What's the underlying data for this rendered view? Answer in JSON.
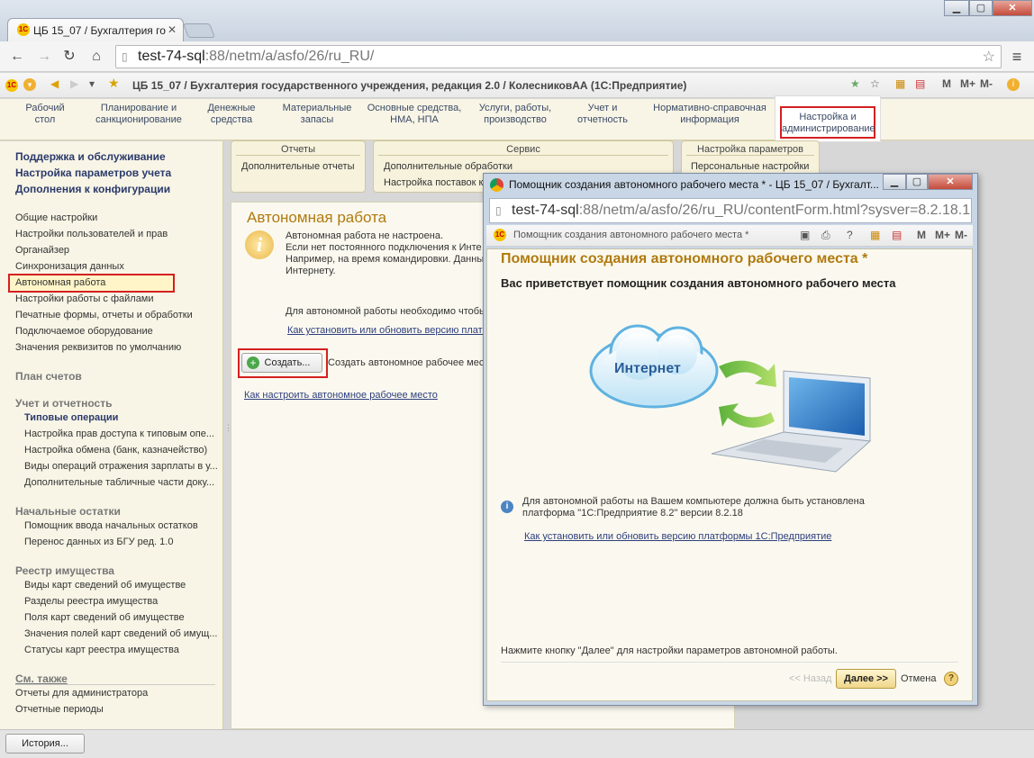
{
  "browser": {
    "tab_title": "ЦБ 15_07 / Бухгалтерия го",
    "url_host": "test-74-sql",
    "url_rest": ":88/netm/a/asfo/26/ru_RU/"
  },
  "app": {
    "title": "ЦБ 15_07 / Бухгалтерия государственного учреждения, редакция 2.0 / КолесниковАА (1С:Предприятие)",
    "toolbar_right": [
      "M",
      "M+",
      "M-"
    ]
  },
  "sections": [
    {
      "label": "Рабочий\nстол"
    },
    {
      "label": "Планирование и\nсанкционирование"
    },
    {
      "label": "Денежные\nсредства"
    },
    {
      "label": "Материальные\nзапасы"
    },
    {
      "label": "Основные средства,\nНМА, НПА"
    },
    {
      "label": "Услуги, работы,\nпроизводство"
    },
    {
      "label": "Учет и\nотчетность"
    },
    {
      "label": "Нормативно-справочная\nинформация"
    },
    {
      "label": "Настройка и\nадминистрирование"
    }
  ],
  "left": {
    "top_links": [
      "Поддержка и обслуживание",
      "Настройка параметров учета",
      "Дополнения к конфигурации"
    ],
    "settings": [
      "Общие настройки",
      "Настройки пользователей и прав",
      "Органайзер",
      "Синхронизация данных",
      "Автономная работа",
      "Настройки работы с файлами",
      "Печатные формы, отчеты и обработки",
      "Подключаемое оборудование",
      "Значения реквизитов по умолчанию"
    ],
    "plan": "План счетов",
    "accounting_header": "Учет и отчетность",
    "accounting_sub": "Типовые операции",
    "accounting_items": [
      "Настройка прав доступа к типовым опе...",
      "Настройка обмена (банк, казначейство)",
      "Виды операций отражения зарплаты в у...",
      "Дополнительные табличные части доку..."
    ],
    "opening_header": "Начальные остатки",
    "opening_items": [
      "Помощник ввода начальных остатков",
      "Перенос данных из БГУ ред. 1.0"
    ],
    "registry_header": "Реестр имущества",
    "registry_items": [
      "Виды карт сведений об имуществе",
      "Разделы реестра имущества",
      "Поля карт сведений об имуществе",
      "Значения полей карт сведений об имущ...",
      "Статусы карт реестра имущества"
    ],
    "seealso_header": "См. также",
    "seealso_items": [
      "Отчеты для администратора",
      "Отчетные периоды"
    ]
  },
  "groups": {
    "reports": {
      "header": "Отчеты",
      "items": [
        "Дополнительные отчеты"
      ]
    },
    "service": {
      "header": "Сервис",
      "items": [
        "Дополнительные обработки",
        "Настройка поставок ко"
      ]
    },
    "params": {
      "header": "Настройка параметров",
      "items": [
        "Персональные настройки"
      ]
    }
  },
  "main": {
    "title": "Автономная работа",
    "info_lines": [
      "Автономная работа не настроена.",
      "Если нет постоянного подключения к Инте",
      "Например, на время командировки. Данны",
      "Интернету."
    ],
    "need_text": "Для автономной работы необходимо чтобы",
    "install_link": "Как установить или обновить версию платф",
    "create_button": "Создать...",
    "create_text": "Создать автономное рабочее место",
    "howto_link": "Как настроить автономное рабочее место"
  },
  "popup": {
    "window_title": "Помощник создания автономного рабочего места * - ЦБ 15_07 / Бухгалт...",
    "url_host": "test-74-sql",
    "url_rest": ":88/netm/a/asfo/26/ru_RU/contentForm.html?sysver=8.2.18.1",
    "inner_title": "Помощник создания автономного рабочего места *",
    "heading": "Помощник создания автономного рабочего места *",
    "welcome": "Вас приветствует помощник создания автономного рабочего места",
    "cloud_label": "Интернет",
    "note_lines": [
      "Для автономной работы на Вашем компьютере должна быть установлена",
      "платформа \"1С:Предприятие 8.2\" версии 8.2.18"
    ],
    "note_link": "Как установить или обновить версию платформы 1С:Предприятие",
    "footer_text": "Нажмите кнопку \"Далее\" для настройки параметров автономной работы.",
    "back": "<< Назад",
    "next": "Далее >>",
    "cancel": "Отмена",
    "help": "?"
  },
  "bottom": {
    "history": "История..."
  },
  "colors": {
    "accent_red": "#d42020",
    "title_gold": "#b07a10",
    "link": "#2d3e7e"
  }
}
